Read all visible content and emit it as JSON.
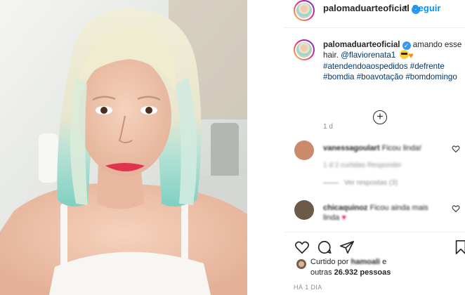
{
  "post": {
    "username": "palomaduarteoficial",
    "follow_label": "Seguir",
    "header_separator": "•"
  },
  "caption": {
    "username": "palomaduarteoficial",
    "text_before_mention": "amando esse hair.",
    "mention": "@flaviorenata1",
    "hashtags_line1": "#atendendoaospedidos #defrente",
    "hashtags_line2": "#bomdia #boavotação #bomdomingo",
    "time": "1 d"
  },
  "comments": [
    {
      "username": "vanessagoulart",
      "text": "Ficou linda!",
      "meta": "1 d   2 curtidas   Responder",
      "avatar_color": "#c98b6a"
    },
    {
      "username": "chicaquinoz",
      "text": "Ficou ainda mais linda",
      "meta": "",
      "avatar_color": "#6b5a48"
    }
  ],
  "view_replies_label": "Ver respostas (3)",
  "likes": {
    "liked_by_prefix": "Curtido por",
    "liked_by_user": "hamoali",
    "liked_by_suffix": "e",
    "others_prefix": "outras",
    "others_count": "26.932",
    "others_suffix": "pessoas"
  },
  "footer_time": "HÁ 1 DIA",
  "icons": {
    "verified": "verified-badge-icon",
    "add_comment": "plus-circle-icon",
    "like": "heart-outline-icon",
    "comment": "speech-bubble-icon",
    "share": "paper-plane-icon",
    "save": "bookmark-icon"
  },
  "colors": {
    "link_blue": "#0095f6",
    "verified_blue": "#3897f0",
    "hashtag": "#00376b",
    "muted": "#8e8e8e"
  }
}
